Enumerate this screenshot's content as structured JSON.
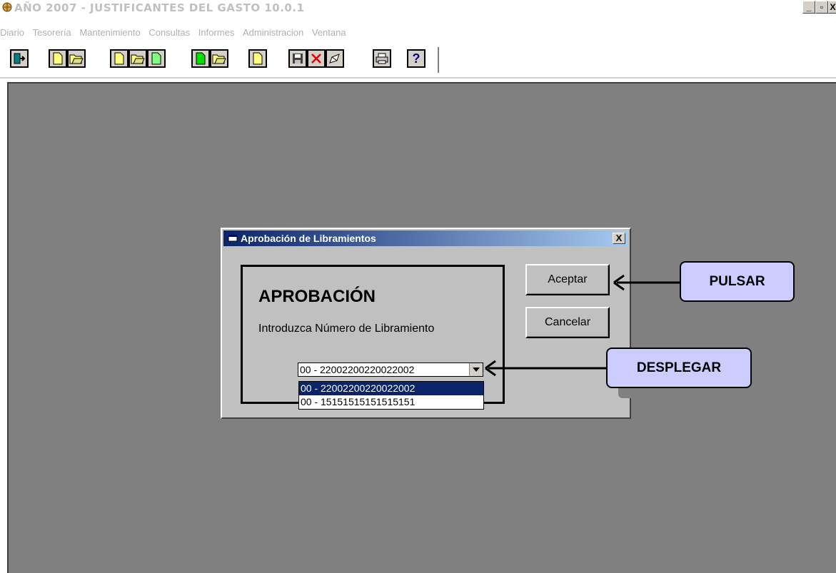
{
  "app": {
    "title": "AÑO 2007 - JUSTIFICANTES DEL GASTO 10.0.1",
    "icon": "app-globe-icon",
    "window_controls": [
      "_",
      "̅",
      "X"
    ]
  },
  "menu": {
    "items": [
      "Diario",
      "Tesorería",
      "Mantenimiento",
      "Consultas",
      "Informes",
      "Administracion",
      "Ventana"
    ]
  },
  "toolbar": {
    "buttons": [
      {
        "icon": "exit-door-icon"
      },
      {
        "icon": "new-document-icon"
      },
      {
        "icon": "open-folder-icon"
      },
      {
        "icon": "new-document-icon"
      },
      {
        "icon": "open-folder-icon"
      },
      {
        "icon": "new-document-icon"
      },
      {
        "icon": "new-document-green-icon"
      },
      {
        "icon": "open-folder-icon"
      },
      {
        "icon": "new-document-icon"
      },
      {
        "icon": "save-disk-icon"
      },
      {
        "icon": "delete-x-icon"
      },
      {
        "icon": "edit-icon"
      },
      {
        "icon": "print-icon"
      },
      {
        "icon": "help-question-icon"
      }
    ]
  },
  "dialog": {
    "title": "Aprobación de Libramientos",
    "close_label": "X",
    "heading": "APROBACIÓN",
    "prompt": "Introduzca Número de Libramiento",
    "accept_label": "Aceptar",
    "cancel_label": "Cancelar",
    "combo": {
      "selected": "00 - 22002200220022002",
      "options": [
        "00 - 22002200220022002",
        "00 - 15151515151515151"
      ]
    }
  },
  "callouts": {
    "pulsar": "PULSAR",
    "desplegar": "DESPLEGAR"
  },
  "colors": {
    "title_gradient_start": "#0a246a",
    "title_gradient_end": "#a6caf0",
    "callout_fill": "#ccccff",
    "mdi_background": "#808080",
    "dialog_background": "#c0c0c0"
  }
}
